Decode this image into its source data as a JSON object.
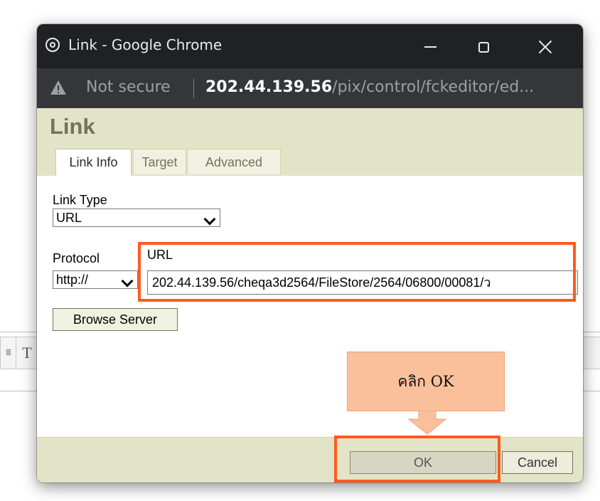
{
  "window": {
    "title": "Link - Google Chrome"
  },
  "address_bar": {
    "security_text": "Not secure",
    "host": "202.44.139.56",
    "path": "/pix/control/fckeditor/ed..."
  },
  "dialog": {
    "title": "Link",
    "tabs": [
      {
        "label": "Link Info",
        "active": true
      },
      {
        "label": "Target",
        "active": false
      },
      {
        "label": "Advanced",
        "active": false
      }
    ],
    "link_type": {
      "label": "Link Type",
      "value": "URL"
    },
    "protocol": {
      "label": "Protocol",
      "value": "http://"
    },
    "url": {
      "label": "URL",
      "value": "202.44.139.56/cheqa3d2564/FileStore/2564/06800/00081/ว"
    },
    "browse_button": "Browse Server",
    "ok_button": "OK",
    "cancel_button": "Cancel"
  },
  "annotation": {
    "callout_text": "คลิก OK",
    "highlight_color": "#ff5a1f",
    "callout_color": "#fac09b"
  },
  "background_editor": {
    "toolbar_glyph": "T"
  }
}
